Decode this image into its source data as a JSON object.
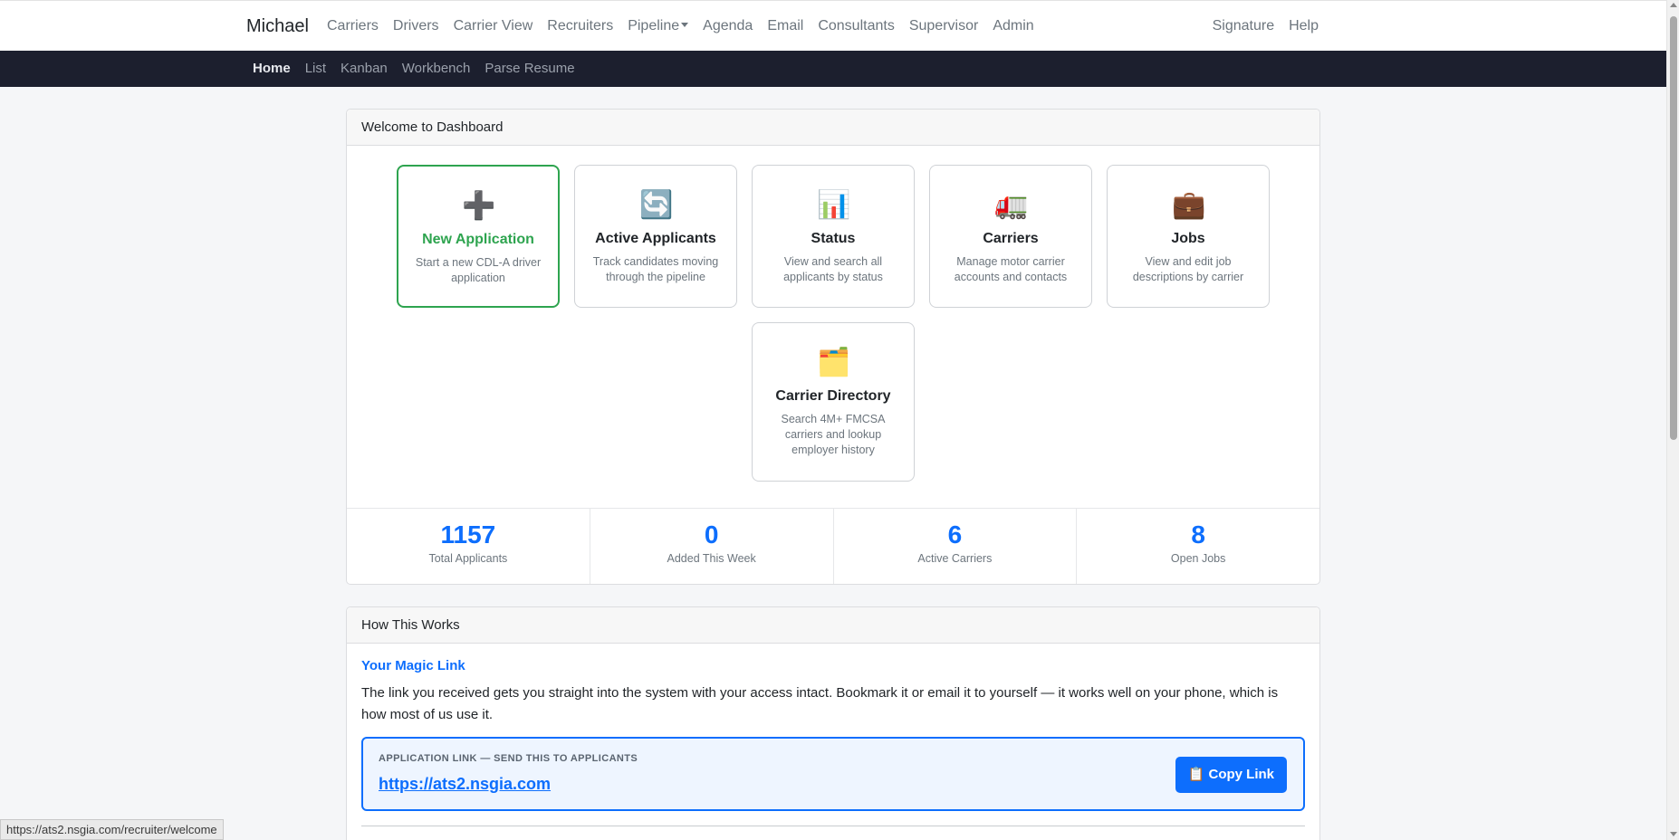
{
  "navbar": {
    "brand": "Michael",
    "left_links": [
      "Carriers",
      "Drivers",
      "Carrier View",
      "Recruiters",
      "Pipeline",
      "Agenda",
      "Email",
      "Consultants",
      "Supervisor",
      "Admin"
    ],
    "dropdown_index": 4,
    "right_links": [
      "Signature",
      "Help"
    ]
  },
  "subnav": {
    "items": [
      "Home",
      "List",
      "Kanban",
      "Workbench",
      "Parse Resume"
    ],
    "active": "Home"
  },
  "dashboard": {
    "header": "Welcome to Dashboard",
    "tiles": [
      {
        "icon": "plus-icon",
        "glyph": "➕",
        "title": "New Application",
        "desc": "Start a new CDL-A driver application"
      },
      {
        "icon": "refresh-icon",
        "glyph": "🔄",
        "title": "Active Applicants",
        "desc": "Track candidates moving through the pipeline"
      },
      {
        "icon": "bar-chart-icon",
        "glyph": "📊",
        "title": "Status",
        "desc": "View and search all applicants by status"
      },
      {
        "icon": "truck-icon",
        "glyph": "🚛",
        "title": "Carriers",
        "desc": "Manage motor carrier accounts and contacts"
      },
      {
        "icon": "briefcase-icon",
        "glyph": "💼",
        "title": "Jobs",
        "desc": "View and edit job descriptions by carrier"
      },
      {
        "icon": "card-index-dividers-icon",
        "glyph": "🗂️",
        "title": "Carrier Directory",
        "desc": "Search 4M+ FMCSA carriers and lookup employer history"
      }
    ],
    "stats": [
      {
        "value": "1157",
        "label": "Total Applicants"
      },
      {
        "value": "0",
        "label": "Added This Week"
      },
      {
        "value": "6",
        "label": "Active Carriers"
      },
      {
        "value": "8",
        "label": "Open Jobs"
      }
    ]
  },
  "how": {
    "header": "How This Works",
    "title": "Your Magic Link",
    "text": "The link you received gets you straight into the system with your access intact. Bookmark it or email it to yourself — it works well on your phone, which is how most of us use it.",
    "link_label": "APPLICATION LINK — SEND THIS TO APPLICANTS",
    "link_url": "https://ats2.nsgia.com",
    "copy_icon": "clipboard-icon",
    "copy_glyph": "📋",
    "copy_label": "Copy Link"
  },
  "status_bar": {
    "url": "https://ats2.nsgia.com/recruiter/welcome"
  },
  "colors": {
    "accent": "#0d6efd",
    "success": "#2ea44f",
    "subnav_bg": "#1c1f2e"
  }
}
